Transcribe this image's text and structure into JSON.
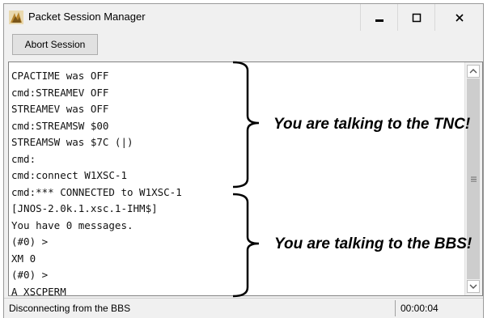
{
  "window": {
    "title": "Packet Session Manager",
    "icons": [
      "app-icon",
      "minimize-icon",
      "maximize-icon",
      "close-icon"
    ]
  },
  "toolbar": {
    "abort_label": "Abort Session"
  },
  "terminal": {
    "lines": [
      "CPACTIME was OFF",
      "cmd:STREAMEV OFF",
      "STREAMEV was OFF",
      "cmd:STREAMSW $00",
      "STREAMSW was $7C (|)",
      "cmd:",
      "cmd:connect W1XSC-1",
      "cmd:*** CONNECTED to W1XSC-1",
      "[JNOS-2.0k.1.xsc.1-IHM$]",
      "You have 0 messages.",
      "(#0) >",
      "XM 0",
      "(#0) >",
      "A XSCPERM"
    ]
  },
  "statusbar": {
    "message": "Disconnecting from the BBS",
    "elapsed": "00:00:04"
  },
  "annotations": {
    "tnc": "You are talking to the TNC!",
    "bbs": "You are talking to the BBS!"
  }
}
